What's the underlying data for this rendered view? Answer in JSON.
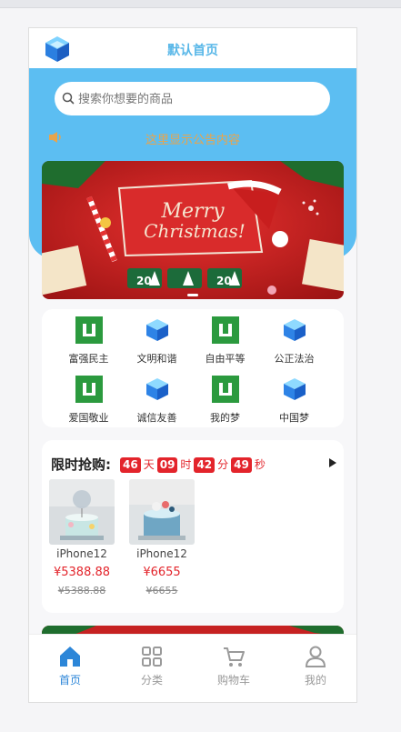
{
  "header": {
    "title": "默认首页",
    "logo_icon": "cube-logo-icon"
  },
  "search": {
    "placeholder": "搜索你想要的商品",
    "icon": "search-icon"
  },
  "notice": {
    "icon": "speaker-icon",
    "text": "这里显示公告内容"
  },
  "banner": {
    "greeting": "Merry Christmas",
    "tags": [
      "20",
      "20"
    ]
  },
  "nav": {
    "items": [
      {
        "label": "富强民主",
        "icon": "green-tag-icon"
      },
      {
        "label": "文明和谐",
        "icon": "blue-cube-icon"
      },
      {
        "label": "自由平等",
        "icon": "green-tag-icon"
      },
      {
        "label": "公正法治",
        "icon": "blue-cube-icon"
      },
      {
        "label": "爱国敬业",
        "icon": "green-tag-icon"
      },
      {
        "label": "诚信友善",
        "icon": "blue-cube-icon"
      },
      {
        "label": "我的梦",
        "icon": "green-tag-icon"
      },
      {
        "label": "中国梦",
        "icon": "blue-cube-icon"
      }
    ]
  },
  "flash_sale": {
    "title": "限时抢购:",
    "countdown": {
      "days": "46",
      "days_unit": "天",
      "hours": "09",
      "hours_unit": "时",
      "minutes": "42",
      "minutes_unit": "分",
      "seconds": "49",
      "seconds_unit": "秒"
    },
    "products": [
      {
        "name": "iPhone12",
        "price": "¥5388.88",
        "original_price": "¥5388.88"
      },
      {
        "name": "iPhone12",
        "price": "¥6655",
        "original_price": "¥6655"
      }
    ]
  },
  "tabbar": {
    "tabs": [
      {
        "label": "首页",
        "icon": "home-icon",
        "active": true
      },
      {
        "label": "分类",
        "icon": "grid-icon",
        "active": false
      },
      {
        "label": "购物车",
        "icon": "cart-icon",
        "active": false
      },
      {
        "label": "我的",
        "icon": "user-icon",
        "active": false
      }
    ]
  },
  "colors": {
    "primary": "#5cbef2",
    "accent_red": "#e3242b",
    "notice": "#e9a44b",
    "active_tab": "#2c86d8"
  }
}
